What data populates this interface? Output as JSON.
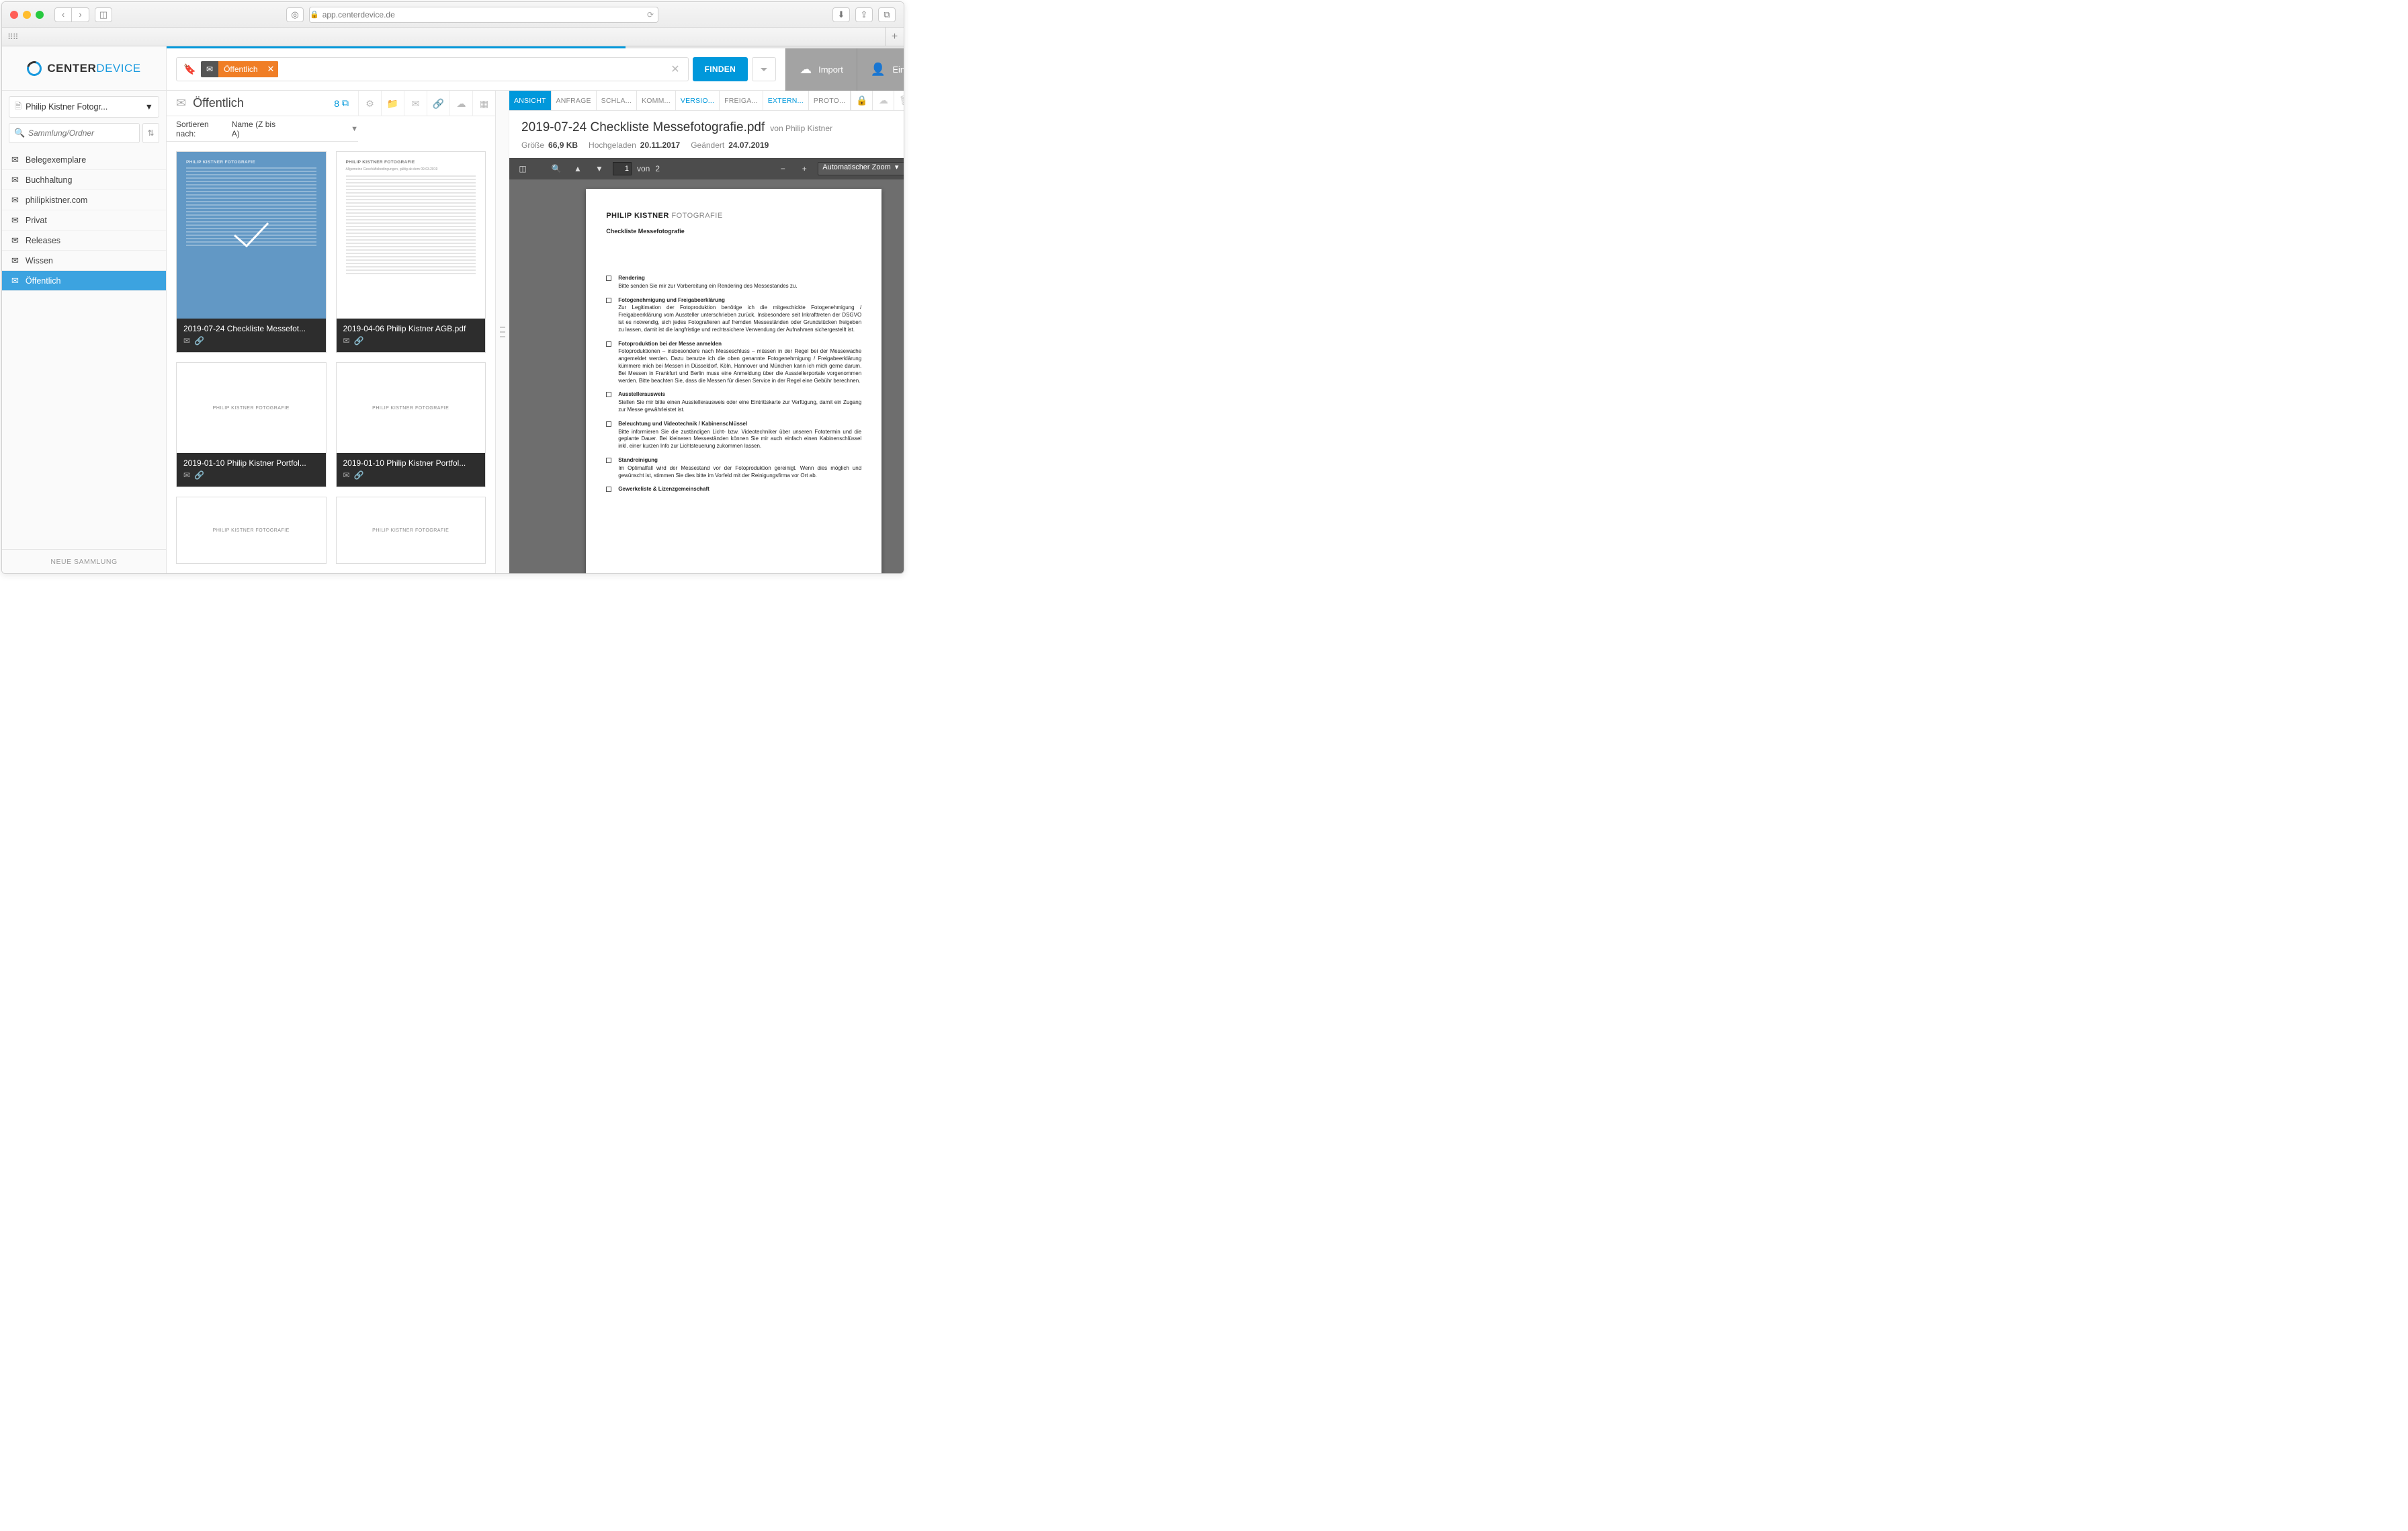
{
  "browser": {
    "url_host": "app.centerdevice.de"
  },
  "logo": {
    "part1": "CENTER",
    "part2": "DEVICE"
  },
  "folder_selector": "Philip Kistner Fotogr...",
  "search_placeholder": "Sammlung/Ordner",
  "nav": [
    {
      "label": "Belegexemplare"
    },
    {
      "label": "Buchhaltung"
    },
    {
      "label": "philipkistner.com"
    },
    {
      "label": "Privat"
    },
    {
      "label": "Releases"
    },
    {
      "label": "Wissen"
    },
    {
      "label": "Öffentlich",
      "active": true
    }
  ],
  "sidebar_footer": "NEUE SAMMLUNG",
  "search_chip": {
    "label": "Öffentlich"
  },
  "find_label": "FINDEN",
  "top_actions": {
    "import": "Import",
    "settings": "Einstellungen"
  },
  "list_title": "Öffentlich",
  "doc_count": "8",
  "sort": {
    "label": "Sortieren nach:",
    "value": "Name (Z bis A)"
  },
  "thumbs_brand": "PHILIP KISTNER FOTOGRAFIE",
  "cards": [
    {
      "name": "2019-07-24 Checkliste Messefot...",
      "selected": true
    },
    {
      "name": "2019-04-06 Philip Kistner AGB.pdf"
    },
    {
      "name": "2019-01-10 Philip Kistner Portfol..."
    },
    {
      "name": "2019-01-10 Philip Kistner Portfol..."
    },
    {
      "name": ""
    },
    {
      "name": ""
    }
  ],
  "tabs": [
    {
      "label": "ANSICHT",
      "state": "active"
    },
    {
      "label": "ANFRAGE"
    },
    {
      "label": "SCHLA..."
    },
    {
      "label": "KOMM..."
    },
    {
      "label": "VERSIO...",
      "state": "highlight"
    },
    {
      "label": "FREIGA..."
    },
    {
      "label": "EXTERN...",
      "state": "highlight"
    },
    {
      "label": "PROTO..."
    }
  ],
  "doc": {
    "title": "2019-07-24 Checkliste Messefotografie.pdf",
    "by_prefix": "von",
    "author": "Philip Kistner",
    "meta": {
      "size_label": "Größe",
      "size": "66,9 KB",
      "uploaded_label": "Hochgeladen",
      "uploaded": "20.11.2017",
      "modified_label": "Geändert",
      "modified": "24.07.2019"
    }
  },
  "pdf_toolbar": {
    "page": "1",
    "page_sep": "von",
    "total": "2",
    "zoom": "Automatischer Zoom"
  },
  "pdf_body": {
    "brand1": "PHILIP KISTNER",
    "brand2": "FOTOGRAFIE",
    "title": "Checkliste Messefotografie",
    "sections": [
      {
        "h": "Rendering",
        "p": "Bitte senden Sie mir zur Vorbereitung ein Rendering des Messestandes zu."
      },
      {
        "h": "Fotogenehmigung und Freigabeerklärung",
        "p": "Zur Legitimation der Fotoproduktion benötige ich die mitgeschickte Fotogenehmigung / Freigabeerklärung vom Aussteller unterschrieben zurück. Insbesondere seit Inkrafttreten der DSGVO ist es notwendig, sich jedes Fotografieren auf fremden Messeständen oder Grundstücken freigeben zu lassen, damit ist die langfristige und rechtssichere Verwendung der Aufnahmen sichergestellt ist."
      },
      {
        "h": "Fotoproduktion bei der Messe anmelden",
        "p": "Fotoproduktionen – insbesondere nach Messeschluss – müssen in der Regel bei der Messewache angemeldet werden. Dazu benutze ich die oben genannte Fotogenehmigung / Freigabeerklärung kümmere mich bei Messen in Düsseldorf, Köln, Hannover und München kann ich mich gerne darum. Bei Messen in Frankfurt und Berlin muss eine Anmeldung über die Ausstellerportale vorgenommen werden. Bitte beachten Sie, dass die Messen für diesen Service in der Regel eine Gebühr berechnen."
      },
      {
        "h": "Ausstellerausweis",
        "p": "Stellen Sie mir bitte einen Ausstellerausweis oder eine Eintrittskarte zur Verfügung, damit ein Zugang zur Messe gewährleistet ist."
      },
      {
        "h": "Beleuchtung und Videotechnik / Kabinenschlüssel",
        "p": "Bitte informieren Sie die zuständigen Licht- bzw. Videotechniker über unseren Fototermin und die geplante Dauer. Bei kleineren Messeständen können Sie mir auch einfach einen Kabinenschlüssel inkl. einer kurzen Info zur Lichtsteuerung zukommen lassen."
      },
      {
        "h": "Standreinigung",
        "p": "Im Optimalfall wird der Messestand vor der Fotoproduktion gereinigt. Wenn dies möglich und gewünscht ist, stimmen Sie dies bitte im Vorfeld mit der Reinigungsfirma vor Ort ab."
      },
      {
        "h": "Gewerkeliste & Lizenzgemeinschaft",
        "p": ""
      }
    ]
  }
}
